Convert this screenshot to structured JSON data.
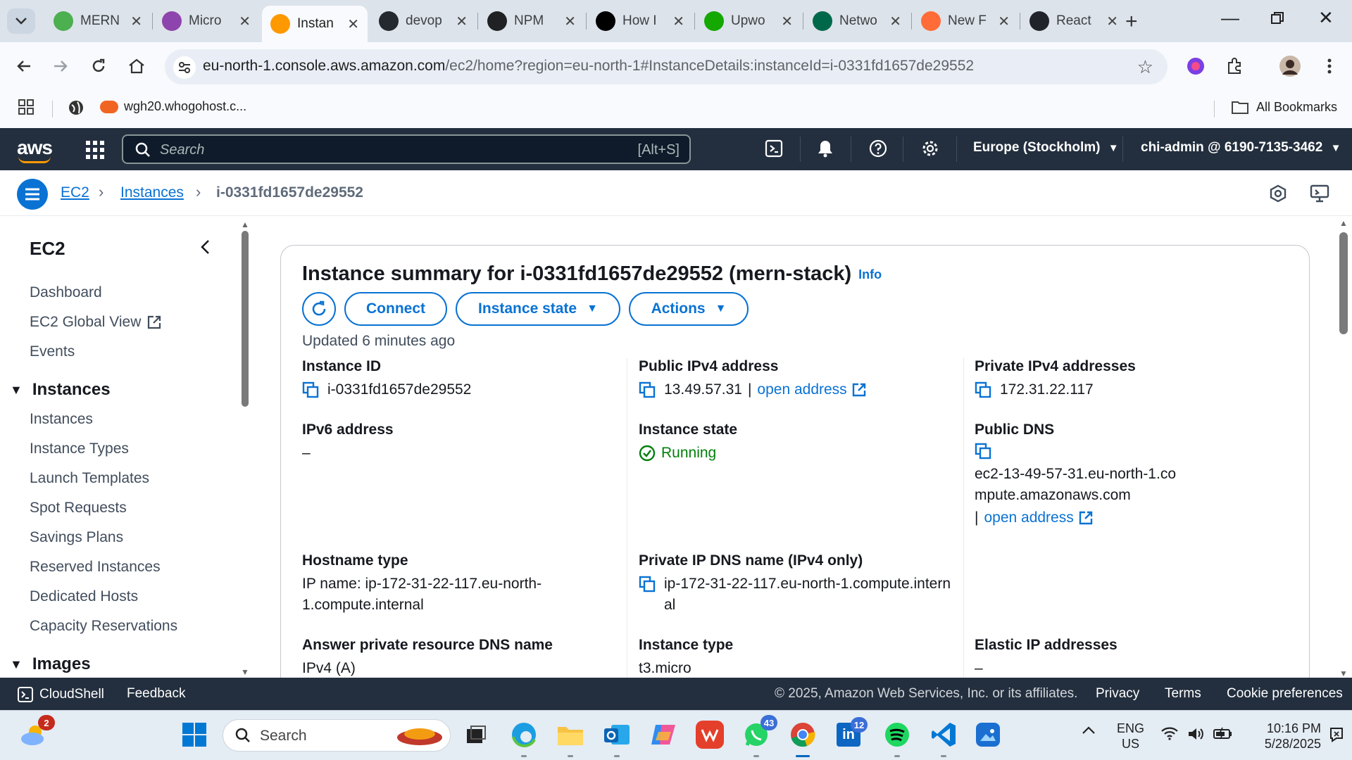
{
  "browser": {
    "tabs": [
      {
        "title": "MERN",
        "icon": "mern-icon",
        "color": "#4caf50"
      },
      {
        "title": "Micro",
        "icon": "copilot-icon",
        "color": "#8e44ad"
      },
      {
        "title": "Instan",
        "icon": "aws-ec2-icon",
        "color": "#ff9900",
        "active": true
      },
      {
        "title": "devop",
        "icon": "github-icon",
        "color": "#24292f"
      },
      {
        "title": "NPM",
        "icon": "openai-icon",
        "color": "#202123"
      },
      {
        "title": "How I",
        "icon": "medium-icon",
        "color": "#000000"
      },
      {
        "title": "Upwo",
        "icon": "upwork-icon",
        "color": "#14a800"
      },
      {
        "title": "Netwo",
        "icon": "mongodb-icon",
        "color": "#00684a"
      },
      {
        "title": "New F",
        "icon": "postman-icon",
        "color": "#ff6c37"
      },
      {
        "title": "React",
        "icon": "react-icon",
        "color": "#20232a"
      }
    ],
    "url_host": "eu-north-1.console.aws.amazon.com",
    "url_path": "/ec2/home?region=eu-north-1#InstanceDetails:instanceId=i-0331fd1657de29552",
    "bookmark_site": "wgh20.whogohost.c...",
    "all_bookmarks": "All Bookmarks"
  },
  "aws": {
    "logo": "aws",
    "search_placeholder": "Search",
    "search_shortcut": "[Alt+S]",
    "region": "Europe (Stockholm)",
    "account": "chi-admin @ 6190-7135-3462",
    "breadcrumb": {
      "service": "EC2",
      "section": "Instances",
      "current": "i-0331fd1657de29552"
    },
    "sidebar": {
      "title": "EC2",
      "top_items": [
        "Dashboard",
        "EC2 Global View",
        "Events"
      ],
      "instances_header": "Instances",
      "instances_items": [
        "Instances",
        "Instance Types",
        "Launch Templates",
        "Spot Requests",
        "Savings Plans",
        "Reserved Instances",
        "Dedicated Hosts",
        "Capacity Reservations"
      ],
      "images_header": "Images"
    },
    "summary": {
      "title": "Instance summary for i-0331fd1657de29552 (mern-stack)",
      "info": "Info",
      "connect": "Connect",
      "instance_state_btn": "Instance state",
      "actions_btn": "Actions",
      "updated": "Updated 6 minutes ago",
      "instance_id_label": "Instance ID",
      "instance_id": "i-0331fd1657de29552",
      "public_ipv4_label": "Public IPv4 address",
      "public_ipv4": "13.49.57.31",
      "open_address": "open address",
      "private_ipv4_label": "Private IPv4 addresses",
      "private_ipv4": "172.31.22.117",
      "ipv6_label": "IPv6 address",
      "ipv6": "–",
      "instance_state_label": "Instance state",
      "instance_state": "Running",
      "public_dns_label": "Public DNS",
      "public_dns": "ec2-13-49-57-31.eu-north-1.compute.amazonaws.com",
      "hostname_type_label": "Hostname type",
      "hostname_type": "IP name: ip-172-31-22-117.eu-north-1.compute.internal",
      "private_dns_label": "Private IP DNS name (IPv4 only)",
      "private_dns": "ip-172-31-22-117.eu-north-1.compute.internal",
      "answer_dns_label": "Answer private resource DNS name",
      "answer_dns": "IPv4 (A)",
      "instance_type_label": "Instance type",
      "instance_type": "t3.micro",
      "elastic_ip_label": "Elastic IP addresses",
      "elastic_ip": "–"
    },
    "footer": {
      "cloudshell": "CloudShell",
      "feedback": "Feedback",
      "copyright": "© 2025, Amazon Web Services, Inc. or its affiliates.",
      "privacy": "Privacy",
      "terms": "Terms",
      "cookies": "Cookie preferences"
    }
  },
  "taskbar": {
    "weather_badge": "2",
    "search_placeholder": "Search",
    "whatsapp_badge": "43",
    "linkedin_badge": "12",
    "lang": "ENG",
    "region": "US",
    "time": "10:16 PM",
    "date": "5/28/2025"
  }
}
